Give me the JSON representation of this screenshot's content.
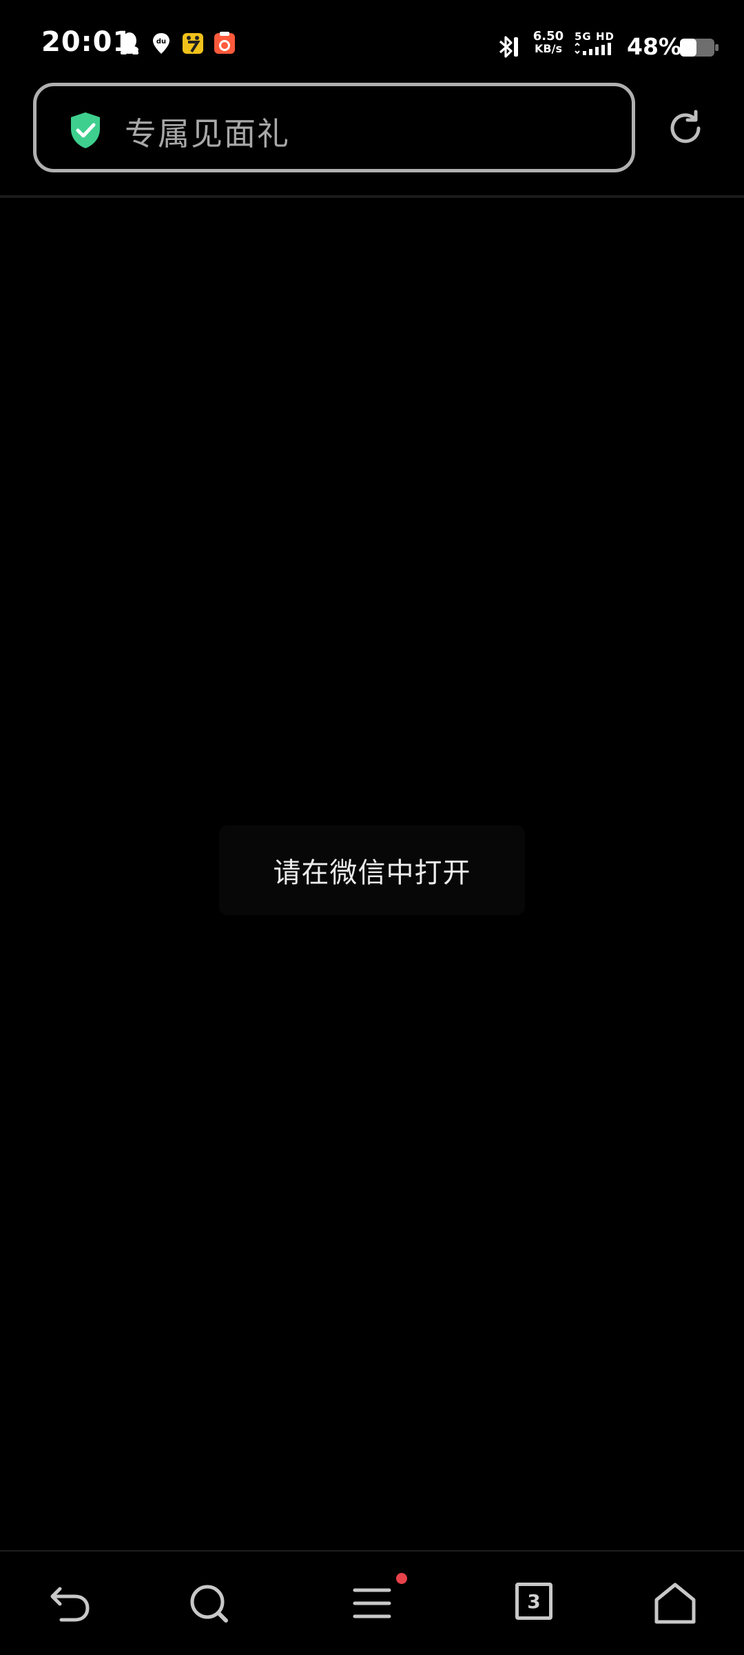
{
  "status_bar": {
    "time": "20:01",
    "notification_icons": [
      "qq-icon",
      "baidu-map-icon",
      "qimao-novel-icon",
      "tomato-novel-icon"
    ],
    "bluetooth_icon": "bluetooth-icon",
    "net_speed_value": "6.50",
    "net_speed_unit": "KB/s",
    "network_label": "5G HD",
    "battery_percent": "48%",
    "battery_level": 0.48
  },
  "address_bar": {
    "title": "专属见面礼",
    "security_icon": "shield-check-icon",
    "reload_icon": "refresh-icon"
  },
  "content": {
    "toast_message": "请在微信中打开"
  },
  "bottom_nav": {
    "back_icon": "back-arrow-icon",
    "search_icon": "search-icon",
    "menu_icon": "menu-icon",
    "menu_has_badge": true,
    "tabs_count": "3",
    "home_icon": "home-icon"
  },
  "colors": {
    "background": "#000000",
    "shield_green": "#3ecf8e",
    "badge_red": "#e8424a",
    "title_gray": "#a8a8a8"
  }
}
